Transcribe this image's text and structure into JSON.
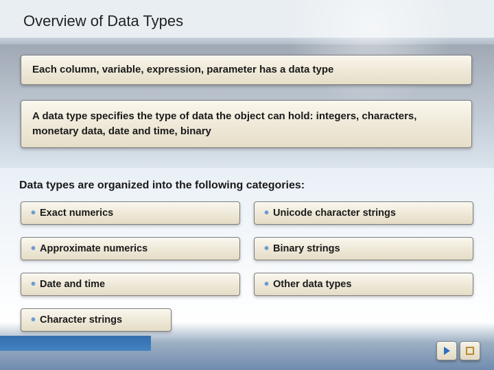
{
  "title": "Overview of Data Types",
  "intro": {
    "line1": "Each column, variable, expression, parameter has a data type",
    "line2": "A data type specifies the type of data the object can hold: integers, characters, monetary data, date and time, binary"
  },
  "subheading": "Data types are organized into the following categories:",
  "categories": {
    "left": [
      "Exact numerics",
      "Approximate numerics",
      "Date and time",
      "Character strings"
    ],
    "right": [
      "Unicode character strings",
      "Binary strings",
      "Other data types"
    ]
  }
}
